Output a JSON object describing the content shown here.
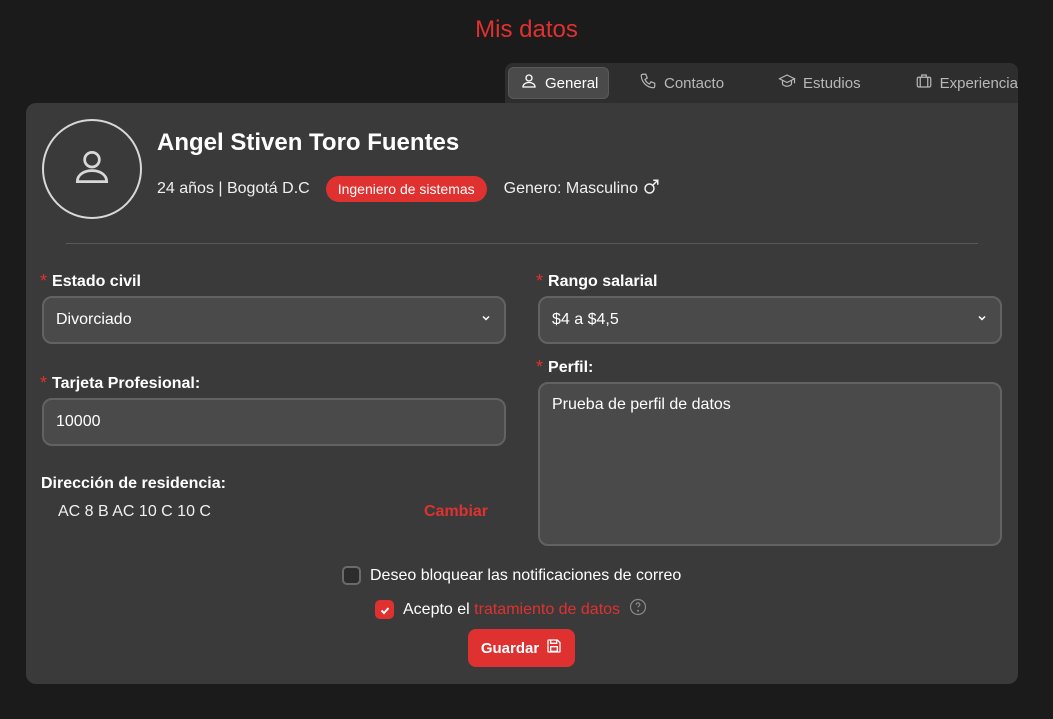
{
  "page": {
    "title": "Mis datos"
  },
  "tabs": [
    {
      "label": "General",
      "icon": "user-icon",
      "active": true
    },
    {
      "label": "Contacto",
      "icon": "phone-icon",
      "active": false
    },
    {
      "label": "Estudios",
      "icon": "graduation-cap-icon",
      "active": false
    },
    {
      "label": "Experiencia",
      "icon": "briefcase-icon",
      "active": false
    }
  ],
  "profile": {
    "name": "Angel Stiven Toro Fuentes",
    "age_location": "24 años | Bogotá D.C",
    "badge": "Ingeniero de sistemas",
    "gender": "Genero: Masculino",
    "avatar_icon": "user-icon"
  },
  "form": {
    "estado_civil": {
      "label": "Estado civil",
      "value": "Divorciado"
    },
    "rango_salarial": {
      "label": "Rango salarial",
      "value": "$4 a $4,5"
    },
    "tarjeta": {
      "label": "Tarjeta Profesional:",
      "value": "10000"
    },
    "perfil": {
      "label": "Perfil:",
      "value": "Prueba de perfil de datos"
    },
    "direccion": {
      "label": "Dirección de residencia:",
      "value": "AC 8 B AC 10 C 10 C",
      "change_label": "Cambiar"
    },
    "required_mark": "*"
  },
  "checks": {
    "block_notifications": {
      "label": "Deseo bloquear las notificaciones de correo",
      "checked": false
    },
    "accept_terms": {
      "label_prefix": "Acepto el",
      "link": "tratamiento de datos",
      "checked": true
    }
  },
  "actions": {
    "save_label": "Guardar"
  },
  "colors": {
    "accent": "#e03131",
    "background": "#1b1b1b",
    "card": "#3a3a3a"
  }
}
